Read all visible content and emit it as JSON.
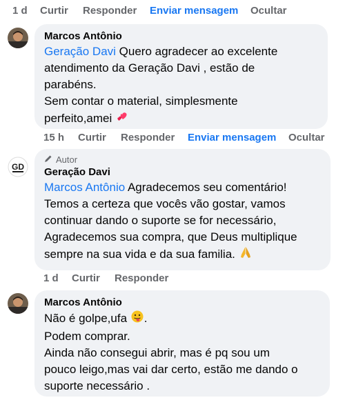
{
  "row1_actions": {
    "time": "1 d",
    "like": "Curtir",
    "reply": "Responder",
    "message": "Enviar mensagem",
    "hide": "Ocultar"
  },
  "comment1": {
    "name": "Marcos Antônio",
    "mention": "Geração Davi",
    "line1_rest": " Quero agradecer ao excelente",
    "line2": "atendimento da Geração Davi , estão de",
    "line3": "parabéns.",
    "line4": "Sem contar o material, simplesmente",
    "line5": "perfeito,amei",
    "emoji": "two-hearts-icon"
  },
  "row2_actions": {
    "time": "15 h",
    "like": "Curtir",
    "reply": "Responder",
    "message": "Enviar mensagem",
    "hide": "Ocultar"
  },
  "comment2": {
    "badge": "Autor",
    "badge_icon": "pencil-icon",
    "name": "Geração Davi",
    "avatar_text": "GD",
    "mention": "Marcos Antônio",
    "line1_rest": " Agradecemos seu comentário!",
    "line2": "Temos a certeza que vocês vão gostar, vamos",
    "line3": "continuar dando o suporte se for necessário,",
    "line4": "Agradecemos sua compra, que Deus multiplique",
    "line5": "sempre na sua vida e da sua familia.",
    "emoji": "praying-hands-icon"
  },
  "row3_actions": {
    "time": "1 d",
    "like": "Curtir",
    "reply": "Responder"
  },
  "comment3": {
    "name": "Marcos Antônio",
    "line1": "Não é golpe,ufa",
    "line1_end": ".",
    "emoji": "tongue-out-face-icon",
    "line2": "Podem comprar.",
    "line3": "Ainda não consegui abrir, mas é pq sou um",
    "line4": "pouco leigo,mas vai dar certo, estão me dando o",
    "line5": "suporte necessário ."
  },
  "colors": {
    "link": "#1877f2",
    "meta": "#65676b",
    "bubble": "#f0f2f5",
    "text": "#050505"
  }
}
